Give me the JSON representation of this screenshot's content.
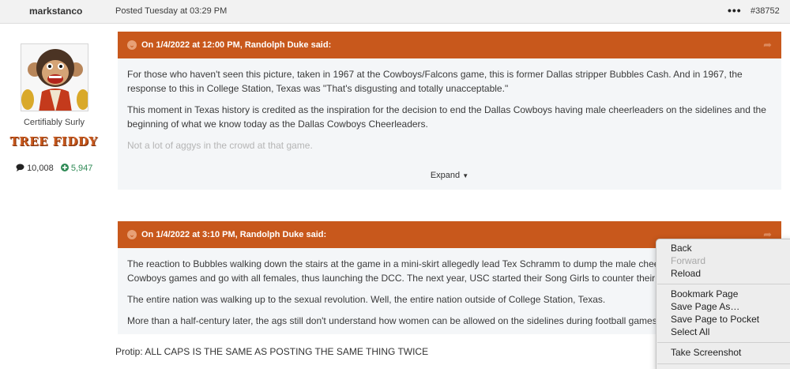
{
  "header": {
    "username": "markstanco",
    "posted": "Posted Tuesday at 03:29 PM",
    "more_label": "•••",
    "post_number": "#38752"
  },
  "user": {
    "title": "Certifiably Surly",
    "banner": "TREE FIDDY",
    "posts_count": "10,008",
    "reputation": "5,947"
  },
  "quote1": {
    "attribution": "On 1/4/2022 at 12:00 PM, Randolph Duke said:",
    "paragraphs": [
      "For those who haven't seen this picture, taken in 1967 at the Cowboys/Falcons game, this is former Dallas stripper Bubbles Cash. And in 1967, the response to this in College Station, Texas was \"That's disgusting and totally unacceptable.\"",
      "This moment in Texas history is credited as the inspiration for the decision to end the Dallas Cowboys having male cheerleaders on the sidelines and the beginning of what we know today as the Dallas Cowboys Cheerleaders.",
      "Not a lot of aggys in the crowd at that game."
    ],
    "expand_label": "Expand"
  },
  "quote2": {
    "attribution": "On 1/4/2022 at 3:10 PM, Randolph Duke said:",
    "paragraphs": [
      "The reaction to Bubbles walking down the stairs at the game in a mini-skirt allegedly lead Tex Schramm to dump the male cheerleaders at Dallas Cowboys games and go with all females, thus launching the DCC. The next year, USC started their Song Girls to counter their all-male",
      "The entire nation was walking up to the sexual revolution. Well, the entire nation outside of College Station, Texas.",
      "More than a half-century later, the ags still don't understand how women can be allowed on the sidelines during football games."
    ]
  },
  "reply_text": "Protip: ALL CAPS IS THE SAME AS POSTING THE SAME THING TWICE",
  "context_menu": {
    "back": "Back",
    "forward": "Forward",
    "reload": "Reload",
    "bookmark": "Bookmark Page",
    "save_as": "Save Page As…",
    "save_pocket": "Save Page to Pocket",
    "select_all": "Select All",
    "screenshot": "Take Screenshot"
  },
  "colors": {
    "quote_header": "#c8581c",
    "quote_background": "#f4f6f8",
    "reputation": "#2e8a55"
  },
  "icons": [
    "chevron-circle-icon",
    "share-arrow-icon",
    "comment-icon",
    "plus-circle-icon",
    "caret-down-icon",
    "more-dots-icon"
  ]
}
